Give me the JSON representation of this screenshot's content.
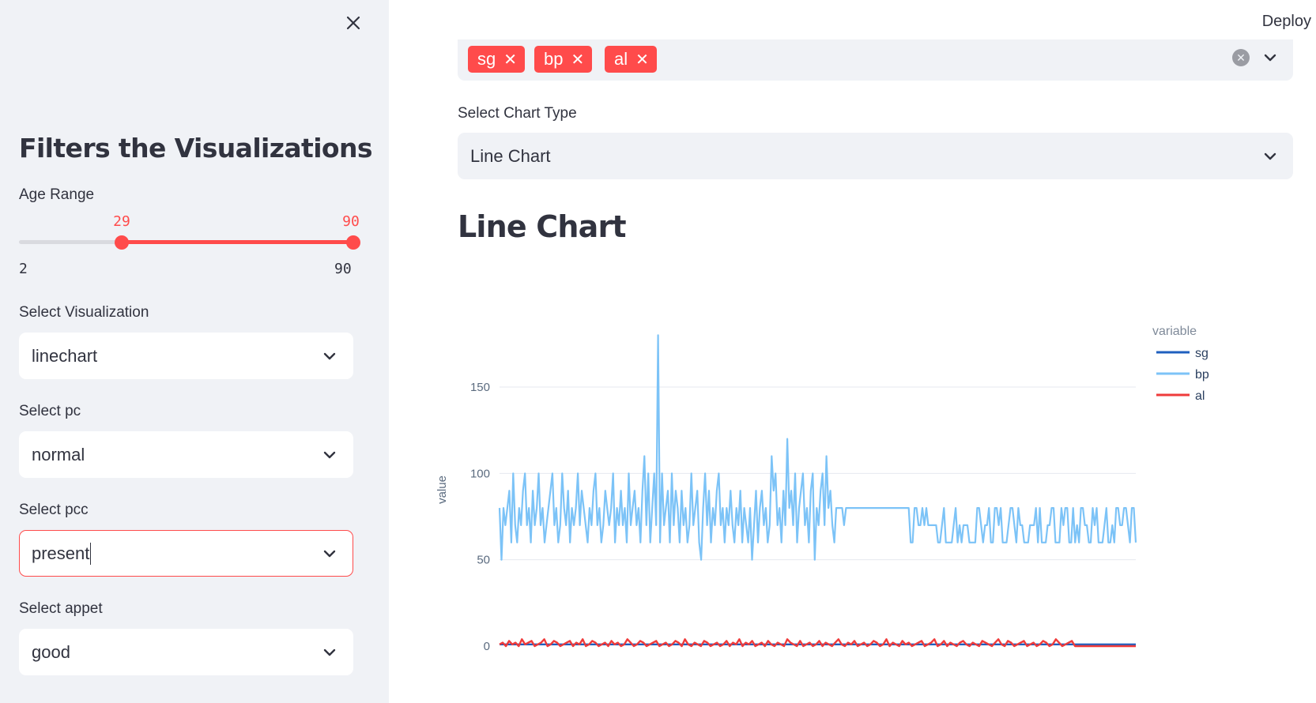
{
  "topbar": {
    "deploy_label": "Deploy"
  },
  "sidebar": {
    "title": "Filters the Visualizations",
    "age_range": {
      "label": "Age Range",
      "min": 2,
      "max": 90,
      "low": 29,
      "high": 90,
      "min_label": "2",
      "max_label": "90",
      "low_label": "29",
      "high_label": "90"
    },
    "selects": [
      {
        "label": "Select Visualization",
        "value": "linechart"
      },
      {
        "label": "Select pc",
        "value": "normal"
      },
      {
        "label": "Select pcc",
        "value": "present"
      },
      {
        "label": "Select appet",
        "value": "good"
      }
    ]
  },
  "main": {
    "multiselect": {
      "tags": [
        "sg",
        "bp",
        "al"
      ]
    },
    "chart_type": {
      "label": "Select Chart Type",
      "value": "Line Chart"
    },
    "heading": "Line Chart"
  },
  "colors": {
    "accent": "#ff4b4b",
    "sg": "#1f5fbf",
    "bp": "#7cc3f7",
    "al": "#ef3b3b",
    "sidebar_bg": "#f0f2f6"
  },
  "chart_data": {
    "type": "line",
    "ylabel": "value",
    "y_ticks": [
      "0",
      "50",
      "100",
      "150"
    ],
    "ylim": [
      0,
      182
    ],
    "legend_title": "variable",
    "legend_position": "right",
    "x_count": 396,
    "series": [
      {
        "name": "sg",
        "values": [
          1.02,
          1.02,
          1.01,
          1.005,
          1.01,
          1.015,
          1.01,
          1.02,
          1.01,
          1.02,
          1.015,
          1.01,
          1.025,
          1.015,
          1.01,
          1.005,
          1.02,
          1.01,
          1.025,
          1.015,
          1.02,
          1.01,
          1.015,
          1.02,
          1.01,
          1.02,
          1.01,
          1.015,
          1.02,
          1.02,
          1.01,
          1.02,
          1.015,
          1.01,
          1.02,
          1.01,
          1.02,
          1.025,
          1.02,
          1.015,
          1.01,
          1.02,
          1.015,
          1.02,
          1.02,
          1.02,
          1.02,
          1.02,
          1.02,
          1.02,
          1.02,
          1.025,
          1.02,
          1.02,
          1.02,
          1.02,
          1.02,
          1.025,
          1.025,
          1.02
        ]
      },
      {
        "name": "bp",
        "values": [
          80,
          50,
          80,
          70,
          80,
          90,
          60,
          100,
          70,
          60,
          80,
          70,
          90,
          100,
          70,
          80,
          60,
          90,
          70,
          80,
          100,
          70,
          80,
          60,
          70,
          80,
          90,
          100,
          70,
          80,
          60,
          70,
          100,
          80,
          70,
          90,
          60,
          80,
          70,
          80,
          100,
          70,
          90,
          80,
          70,
          60,
          80,
          70,
          90,
          100,
          70,
          80,
          60,
          70,
          90,
          80,
          70,
          80,
          100,
          60,
          80,
          70,
          90,
          70,
          80,
          60,
          100,
          70,
          80,
          90,
          70,
          80,
          60,
          90,
          110,
          70,
          100,
          60,
          80,
          100,
          70,
          180,
          60,
          100,
          70,
          80,
          90,
          60,
          100,
          70,
          90,
          80,
          60,
          90,
          70,
          80,
          60,
          70,
          100,
          70,
          80,
          90,
          60,
          50,
          80,
          100,
          70,
          90,
          60,
          80,
          70,
          90,
          100,
          70,
          80,
          60,
          80,
          70,
          90,
          70,
          60,
          80,
          70,
          90,
          60,
          80,
          70,
          60,
          80,
          50,
          70,
          90,
          60,
          80,
          90,
          70,
          80,
          60,
          70,
          110,
          90,
          100,
          70,
          80,
          60,
          90,
          70,
          120,
          80,
          90,
          70,
          100,
          60,
          80,
          90,
          100,
          70,
          80,
          60,
          90,
          100,
          50,
          80,
          70,
          90,
          100,
          70,
          110,
          80,
          90,
          70,
          60,
          80,
          80,
          80,
          80,
          70,
          80,
          80,
          80,
          80,
          80,
          80,
          80,
          80,
          80,
          80,
          80,
          80,
          80,
          80,
          80,
          80,
          80,
          80,
          80,
          80,
          80,
          80,
          80,
          80,
          80,
          80,
          80,
          80,
          80,
          80,
          80,
          80,
          80,
          60,
          60,
          80,
          80,
          70,
          70,
          80,
          70,
          80,
          70,
          70,
          70,
          70,
          70,
          60,
          60,
          70,
          80,
          60,
          60,
          60,
          60,
          70,
          80,
          60,
          70,
          60,
          70,
          70,
          70,
          60,
          60,
          60,
          60,
          80,
          80,
          70,
          60,
          70,
          70,
          80,
          60,
          60,
          80,
          80,
          70,
          80,
          60,
          60,
          60,
          70,
          80,
          80,
          70,
          60,
          80,
          70,
          70,
          60,
          60,
          60,
          70,
          70,
          70,
          80,
          60,
          80,
          60,
          60,
          60,
          70,
          70,
          80,
          80,
          60,
          60,
          60,
          80,
          70,
          80,
          80,
          60,
          60,
          80,
          60,
          70,
          60,
          80,
          80,
          70,
          70,
          60,
          60,
          80,
          70,
          80,
          60,
          60,
          60,
          70,
          80,
          60,
          60,
          70,
          60,
          80,
          80,
          70,
          70,
          80,
          80,
          70,
          60,
          80,
          80,
          60
        ]
      },
      {
        "name": "al",
        "values": [
          1,
          2,
          0,
          3,
          1,
          2,
          0,
          4,
          1,
          2,
          3,
          0,
          1,
          2,
          4,
          0,
          1,
          3,
          2,
          0,
          1,
          2,
          3,
          0,
          2,
          1,
          4,
          0,
          1,
          3,
          2,
          0,
          1,
          2,
          0,
          3,
          1,
          2,
          0,
          1,
          4,
          2,
          0,
          1,
          3,
          2,
          0,
          1,
          2,
          3,
          0,
          1,
          2,
          0,
          1,
          3,
          2,
          0,
          4,
          1,
          0,
          2,
          1,
          0,
          3,
          2,
          0,
          1,
          2,
          0,
          1,
          3,
          0,
          2,
          1,
          4,
          0,
          2,
          1,
          3,
          0,
          1,
          2,
          0,
          3,
          1,
          0,
          2,
          1,
          0,
          4,
          2,
          1,
          0,
          3,
          0,
          1,
          2,
          0,
          1,
          3,
          0,
          2,
          1,
          0,
          2,
          4,
          1,
          0,
          2,
          1,
          3,
          0,
          1,
          2,
          0,
          1,
          3,
          2,
          0,
          1,
          4,
          0,
          2,
          1,
          0,
          3,
          1,
          2,
          0,
          1,
          2,
          3,
          0,
          1,
          2,
          4,
          0,
          1,
          3,
          0,
          2,
          1,
          0,
          2,
          3,
          1,
          0,
          2,
          1,
          0,
          3,
          2,
          1,
          0,
          2,
          4,
          1,
          0,
          3,
          2,
          0,
          1,
          2,
          3,
          0,
          1,
          2,
          0,
          1,
          3,
          2,
          0,
          1,
          4,
          2,
          0,
          1,
          2,
          3,
          0,
          0,
          0,
          0,
          0,
          0,
          0,
          0,
          0,
          0,
          0,
          0,
          0,
          0,
          0,
          0,
          0,
          0,
          0,
          0
        ]
      }
    ]
  }
}
